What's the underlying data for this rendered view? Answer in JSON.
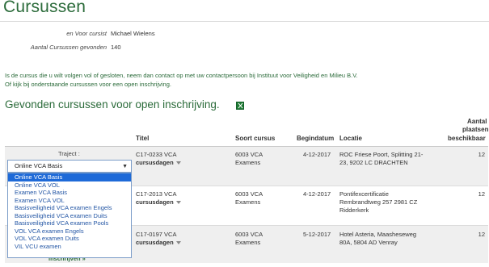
{
  "page": {
    "title": "Cursussen"
  },
  "summary": {
    "cursist_label": "en Voor cursist",
    "cursist_value": "Michael Wielens",
    "count_label": "Aantal Cursussen gevonden",
    "count_value": "140"
  },
  "intro": {
    "line1": "Is de cursus die u wilt volgen vol of gesloten, neem dan contact op met uw contactpersoon bij Instituut voor Veiligheid en Milieu B.V.",
    "line2": "Of kijk bij onderstaande cursussen voor een open inschrijving."
  },
  "section": {
    "title": "Gevonden cursussen voor open inschrijving.",
    "export_icon": "excel-icon"
  },
  "table": {
    "headers": {
      "titel": "Titel",
      "soort": "Soort cursus",
      "begindatum": "Begindatum",
      "locatie": "Locatie",
      "plaatsen_1": "Aantal",
      "plaatsen_2": "plaatsen",
      "plaatsen_3": "beschikbaar"
    },
    "rows": [
      {
        "code": "C17-0233 VCA",
        "dagen": "cursusdagen",
        "soort_1": "6003 VCA",
        "soort_2": "Examens",
        "begindatum": "4-12-2017",
        "locatie_1": "ROC Friese Poort, Splitting 21-",
        "locatie_2": "23, 9202 LC DRACHTEN",
        "locatie_3": "",
        "plaatsen": "12"
      },
      {
        "code": "C17-2013 VCA",
        "dagen": "cursusdagen",
        "soort_1": "6003 VCA",
        "soort_2": "Examens",
        "begindatum": "4-12-2017",
        "locatie_1": "Pontifexcertificatie",
        "locatie_2": "Rembrandtweg 257 2981 CZ",
        "locatie_3": "Ridderkerk",
        "plaatsen": "12"
      },
      {
        "code": "C17-0197 VCA",
        "dagen": "cursusdagen",
        "soort_1": "6003 VCA",
        "soort_2": "Examens",
        "begindatum": "5-12-2017",
        "locatie_1": "Hotel Asteria, Maasheseweg",
        "locatie_2": "80A, 5804 AD Venray",
        "locatie_3": "",
        "plaatsen": "12"
      }
    ]
  },
  "traject": {
    "label": "Traject :",
    "selected": "Online VCA Basis",
    "options": [
      "Online VCA Basis",
      "Online VCA VOL",
      "Examen VCA Basis",
      "Examen VCA VOL",
      "Basisveiligheid VCA examen Engels",
      "Basisveiligheid VCA examen Duits",
      "Basisveiligheid VCA examen Pools",
      "VOL VCA examen Engels",
      "VOL VCA examen Duits",
      "VIL VCU examen"
    ]
  },
  "actions": {
    "inschrijven": "inschrijven »"
  }
}
